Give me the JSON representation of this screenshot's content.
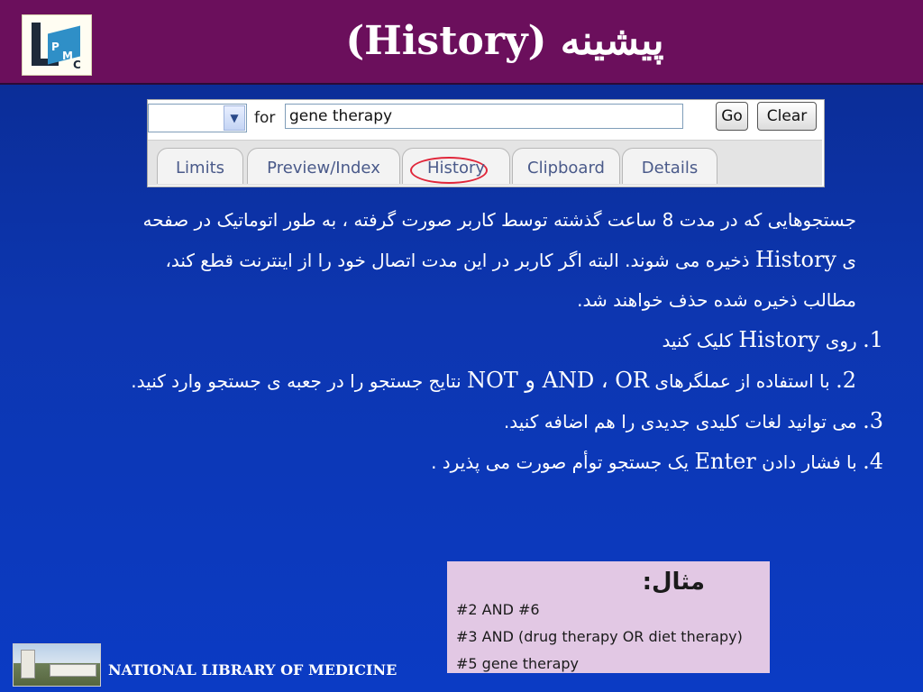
{
  "title_bar": {
    "title": "(History) پیشینه",
    "logo_letters": [
      "P",
      "M",
      "C"
    ]
  },
  "search_panel": {
    "for_label": "for",
    "search_value": "gene therapy",
    "go_label": "Go",
    "clear_label": "Clear",
    "tabs": [
      {
        "label": "Limits"
      },
      {
        "label": "Preview/Index"
      },
      {
        "label": "History",
        "highlighted": true
      },
      {
        "label": "Clipboard"
      },
      {
        "label": "Details"
      }
    ]
  },
  "content": {
    "intro": {
      "part1": "جستجوهایی که در مدت 8 ساعت گذشته توسط کاربر صورت گرفته ، به طور اتوماتیک در صفحه ی",
      "term": "History",
      "part2": "ذخیره می شوند. البته اگر کاربر در این مدت اتصال خود را از اینترنت قطع کند، مطالب ذخیره شده حذف خواهند شد."
    },
    "items": [
      {
        "num": "1.",
        "pre": "روی",
        "term": "History",
        "post": "کلیک کنید"
      },
      {
        "num": "2.",
        "pre": "با استفاده از عملگرهای",
        "term": "AND ، OR و NOT",
        "post": "نتایج جستجو را در جعبه ی جستجو وارد کنید."
      },
      {
        "num": "3.",
        "pre": "می توانید لغات کلیدی جدیدی را هم اضافه کنید.",
        "term": "",
        "post": ""
      },
      {
        "num": "4.",
        "pre": "با فشار دادن",
        "term": "Enter",
        "post": "یک جستجو توأم صورت می پذیرد ."
      }
    ]
  },
  "example": {
    "title": "مثال:",
    "lines": [
      "#2 AND #6",
      "#3 AND (drug therapy OR diet therapy)",
      "#5 gene therapy"
    ]
  },
  "footer": {
    "label": "NATIONAL LIBRARY OF MEDICINE"
  },
  "colors": {
    "title_bar": "#6b0f5c",
    "background": "#0d36b0",
    "example_bg": "#e2c8e4",
    "highlight_circle": "#e0263a"
  }
}
